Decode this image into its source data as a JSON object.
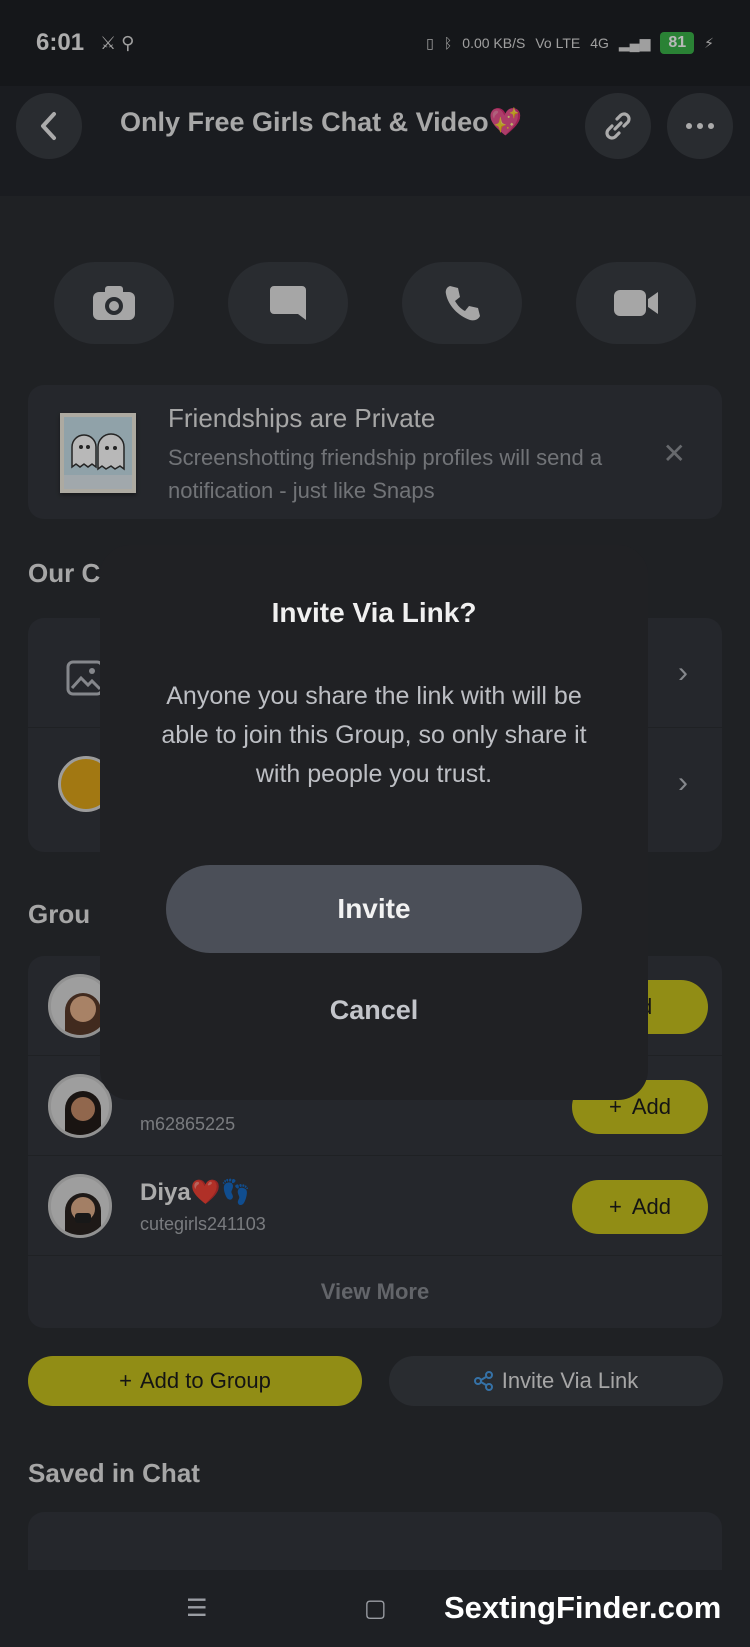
{
  "status_bar": {
    "time": "6:01",
    "left_icons": "⚔ ⚲",
    "network": "0.00 KB/S",
    "volte": "Vo LTE",
    "signal": "4G",
    "battery": "81"
  },
  "header": {
    "title": "Only Free Girls Chat & Video💖"
  },
  "banner": {
    "title": "Friendships are Private",
    "body": "Screenshotting friendship profiles will send a notification - just like Snaps"
  },
  "sections": {
    "our": "Our C",
    "group": "Grou",
    "saved": "Saved in Chat"
  },
  "members": [
    {
      "name": "",
      "username": "",
      "add_label": "dd"
    },
    {
      "name": "",
      "username": "m62865225",
      "add_label": "Add"
    },
    {
      "name": "Diya❤️👣",
      "username": "cutegirls241103",
      "add_label": "Add"
    }
  ],
  "view_more": "View More",
  "buttons": {
    "add_to_group": "Add to Group",
    "invite_via_link": "Invite Via Link"
  },
  "dialog": {
    "title": "Invite Via Link?",
    "body": "Anyone you share the link with will be able to join this Group, so only share it with people you trust.",
    "primary": "Invite",
    "secondary": "Cancel"
  },
  "watermark": "SextingFinder.com",
  "colors": {
    "accent_yellow": "#c9c41e",
    "background": "#2b2e33",
    "card": "#34373d",
    "dialog": "#202124"
  }
}
